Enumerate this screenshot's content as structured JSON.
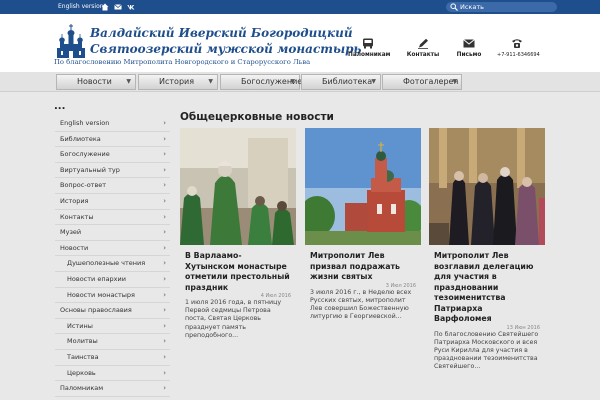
{
  "topbar": {
    "english_label": "English version",
    "icons": [
      "home-icon",
      "mail-icon",
      "vk-icon"
    ],
    "search_placeholder": "Искать"
  },
  "header": {
    "title_line1": "Валдайский Иверский Богородицкий",
    "title_line2": "Святоозерский мужской монастырь",
    "subtitle": "По благословению Митрополита Новгородского и Старорусского Льва",
    "icons": [
      {
        "name": "bus-icon",
        "label": "Паломникам"
      },
      {
        "name": "pen-icon",
        "label": "Контакты"
      },
      {
        "name": "envelope-icon",
        "label": "Письмо"
      },
      {
        "name": "phone-icon",
        "label": "+7-911-6346694"
      }
    ]
  },
  "nav": [
    "Новости",
    "История",
    "Богослужение",
    "Библиотека",
    "Фотогалерея"
  ],
  "sidebar": {
    "title": "...",
    "items": [
      {
        "label": "English version",
        "sub": false,
        "arrow": true
      },
      {
        "label": "Библиотека",
        "sub": false,
        "arrow": true
      },
      {
        "label": "Богослужение",
        "sub": false,
        "arrow": true
      },
      {
        "label": "Виртуальный тур",
        "sub": false,
        "arrow": true
      },
      {
        "label": "Вопрос-ответ",
        "sub": false,
        "arrow": true
      },
      {
        "label": "История",
        "sub": false,
        "arrow": true
      },
      {
        "label": "Контакты",
        "sub": false,
        "arrow": true
      },
      {
        "label": "Музей",
        "sub": false,
        "arrow": true
      },
      {
        "label": "Новости",
        "sub": false,
        "arrow": true
      },
      {
        "label": "Душеполезные чтения",
        "sub": true,
        "arrow": true
      },
      {
        "label": "Новости епархии",
        "sub": true,
        "arrow": true
      },
      {
        "label": "Новости монастыря",
        "sub": true,
        "arrow": true
      },
      {
        "label": "Основы православия",
        "sub": false,
        "arrow": true
      },
      {
        "label": "Истины",
        "sub": true,
        "arrow": true
      },
      {
        "label": "Молитвы",
        "sub": true,
        "arrow": true
      },
      {
        "label": "Таинства",
        "sub": true,
        "arrow": true
      },
      {
        "label": "Церковь",
        "sub": true,
        "arrow": true
      },
      {
        "label": "Паломникам",
        "sub": false,
        "arrow": true
      }
    ]
  },
  "main": {
    "heading": "Общецерковные новости",
    "cards": [
      {
        "title": "В Варлаамо-Хутынском монастыре отметили престольный праздник",
        "date": "4 Июл 2016",
        "excerpt": "1 июля 2016 года, в пятницу Первой седмицы Петрова поста, Святая Церковь празднует память преподобного..."
      },
      {
        "title": "Митрополит Лев призвал подражать жизни святых",
        "date": "3 Июл 2016",
        "excerpt": "3 июля 2016 г., в Неделю всех Русских святых, митрополит Лев совершил Божественную литургию в Георгиевской..."
      },
      {
        "title": "Митрополит Лев возглавил делегацию для участия в праздновании тезоименитства Патриарха Варфоломея",
        "date": "13 Июн 2016",
        "excerpt": "По благословению Святейшего Патриарха Московского и всея Руси Кирилла для участия в праздновании тезоименитства Святейшего..."
      }
    ]
  },
  "colors": {
    "brand_blue": "#1f4e8c",
    "page_background": "#e8e8e8"
  }
}
